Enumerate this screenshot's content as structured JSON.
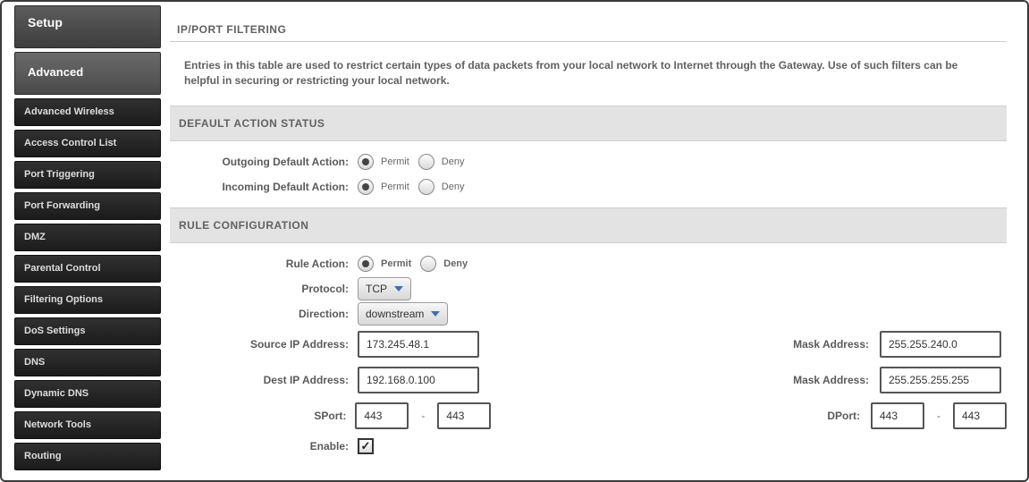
{
  "sidebar": {
    "setup": "Setup",
    "advanced": "Advanced",
    "items": [
      "Advanced Wireless",
      "Access Control List",
      "Port Triggering",
      "Port Forwarding",
      "DMZ",
      "Parental Control",
      "Filtering Options",
      "DoS Settings",
      "DNS",
      "Dynamic DNS",
      "Network Tools",
      "Routing"
    ]
  },
  "page": {
    "title": "IP/PORT FILTERING",
    "intro": "Entries in this table are used to restrict certain types of data packets from your local network to Internet through the Gateway. Use of such filters can be helpful in securing or restricting your local network."
  },
  "default_action": {
    "header": "DEFAULT ACTION STATUS",
    "outgoing_label": "Outgoing Default Action:",
    "incoming_label": "Incoming Default Action:",
    "permit": "Permit",
    "deny": "Deny",
    "outgoing_value": "Permit",
    "incoming_value": "Permit"
  },
  "rule": {
    "header": "RULE CONFIGURATION",
    "action_label": "Rule Action:",
    "permit": "Permit",
    "deny": "Deny",
    "action_value": "Permit",
    "protocol_label": "Protocol:",
    "protocol_value": "TCP",
    "direction_label": "Direction:",
    "direction_value": "downstream",
    "source_ip_label": "Source IP Address:",
    "source_ip_value": "173.245.48.1",
    "source_mask_label": "Mask Address:",
    "source_mask_value": "255.255.240.0",
    "dest_ip_label": "Dest IP Address:",
    "dest_ip_value": "192.168.0.100",
    "dest_mask_label": "Mask Address:",
    "dest_mask_value": "255.255.255.255",
    "sport_label": "SPort:",
    "sport_from": "443",
    "sport_to": "443",
    "dport_label": "DPort:",
    "dport_from": "443",
    "dport_to": "443",
    "dash": "-",
    "enable_label": "Enable:",
    "enable_value": true
  }
}
